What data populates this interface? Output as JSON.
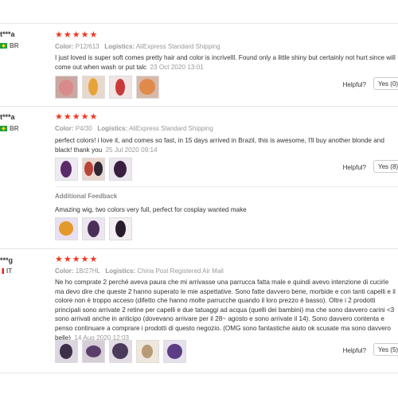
{
  "reviews": [
    {
      "user": "t***a",
      "country": "BR",
      "stars": "★★★★★",
      "color_label": "Color:",
      "color": "P12/613",
      "logistics_label": "Logistics:",
      "logistics": "AliExpress Standard Shipping",
      "text": "I just loved is super soft comes pretty hair and color is incrivelll. Found only a little shiny but certainly not hurt since will come out when wash or put talc",
      "date": "23 Oct 2020 13:01",
      "helpful_label": "Helpful?",
      "yes_label": "Yes (0)"
    },
    {
      "user": "t***a",
      "country": "BR",
      "stars": "★★★★★",
      "color_label": "Color:",
      "color": "P4/30",
      "logistics_label": "Logistics:",
      "logistics": "AliExpress Standard Shipping",
      "text": "perfect colors! i love it, and comes so fast, in 15 days arrived in Brazil, this is awesome, I'll buy another blonde and black! thank you",
      "date": "25 Jul 2020 09:14",
      "helpful_label": "Helpful?",
      "yes_label": "Yes (8)",
      "additional_feedback_label": "Additional Feedback",
      "additional_feedback_text": "Amazing wig, two colors very full, perfect for cosplay wanted make"
    },
    {
      "user": "***g",
      "country": "IT",
      "stars": "★★★★★",
      "color_label": "Color:",
      "color": "1B/27HL",
      "logistics_label": "Logistics:",
      "logistics": "China Post Registered Air Mail",
      "text": "Ne ho comprate 2 perché aveva paura che mi arrivasse una parrucca fatta male e quindi avevo intenzione di cucirle ma devo dire che queste 2 hanno superato le mie aspettative. Sono fatte davvero bene, morbide e con tanti capelli e il colore non è troppo acceso (difetto che hanno molte parrucche quando il loro prezzo è basso). Oltre i 2 prodotti principali sono arrivate 2 retine per capelli e due tatuaggi ad acqua (quelli dei bambini) ma che sono davvero carini <3 sono arrivati anche in anticipo (dovevano arrivare per il 28~ agosto e sono arrivate il 14). Sono davvero contenta e penso continuare a comprare i prodotti di questo negozio. (OMG sono fantastiche aiuto ok scusate ma sono davvero belle)",
      "date": "14 Aug 2020 12:03",
      "helpful_label": "Helpful?",
      "yes_label": "Yes (5)"
    }
  ]
}
